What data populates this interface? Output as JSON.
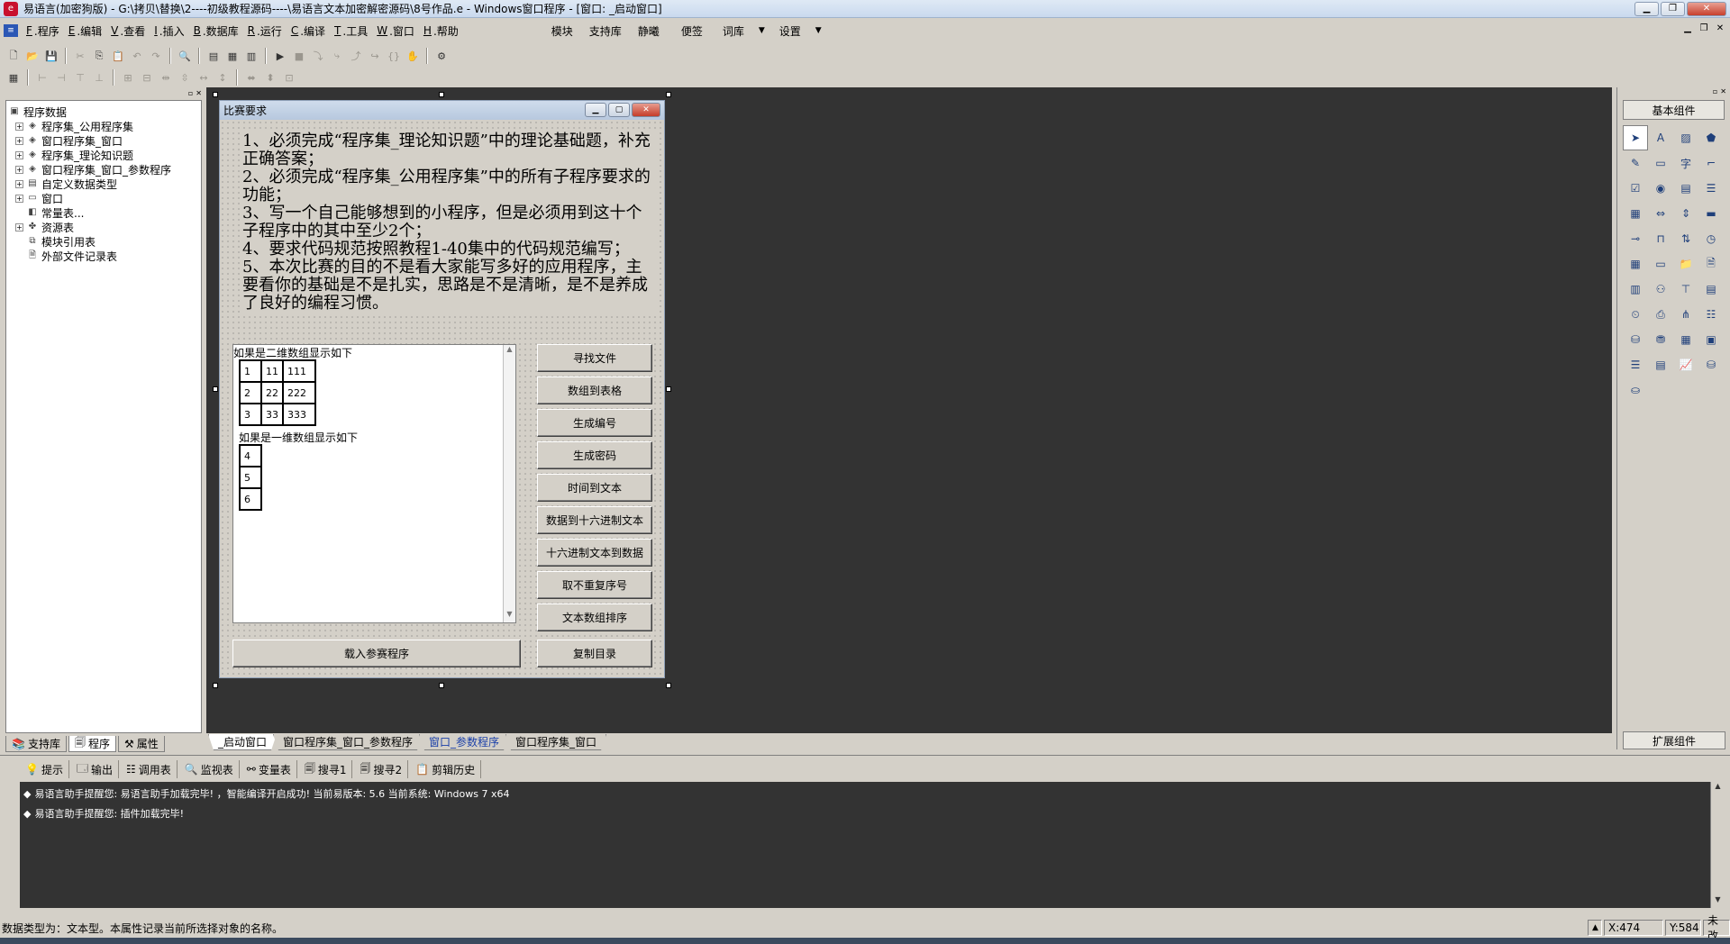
{
  "app": {
    "title": "易语言(加密狗版) - G:\\拷贝\\替换\\2----初级教程源码----\\易语言文本加密解密源码\\8号作品.e - Windows窗口程序 - [窗口: _启动窗口]",
    "icon": "e-lang-app-icon",
    "window_buttons": [
      "minimize-icon",
      "restore-icon",
      "close-icon"
    ]
  },
  "menu": {
    "items": [
      {
        "key": "F",
        "label": ".程序"
      },
      {
        "key": "E",
        "label": ".编辑"
      },
      {
        "key": "V",
        "label": ".查看"
      },
      {
        "key": "I",
        "label": ".插入"
      },
      {
        "key": "B",
        "label": ".数据库"
      },
      {
        "key": "R",
        "label": ".运行"
      },
      {
        "key": "C",
        "label": ".编译"
      },
      {
        "key": "T",
        "label": ".工具"
      },
      {
        "key": "W",
        "label": ".窗口"
      },
      {
        "key": "H",
        "label": ".帮助"
      }
    ],
    "extra": [
      "模块",
      "支持库",
      "静曦",
      "便签",
      "词库",
      "设置"
    ]
  },
  "project_tree": {
    "root": "程序数据",
    "items": [
      {
        "label": "程序集_公用程序集",
        "icon": "module-icon",
        "expandable": true
      },
      {
        "label": "窗口程序集_窗口",
        "icon": "module-icon",
        "expandable": true
      },
      {
        "label": "程序集_理论知识题",
        "icon": "module-icon",
        "expandable": true
      },
      {
        "label": "窗口程序集_窗口_参数程序",
        "icon": "module-icon",
        "expandable": true
      },
      {
        "label": "自定义数据类型",
        "icon": "datatype-icon",
        "expandable": true
      },
      {
        "label": "窗口",
        "icon": "window-icon",
        "expandable": true
      },
      {
        "label": "常量表...",
        "icon": "constant-icon",
        "expandable": false
      },
      {
        "label": "资源表",
        "icon": "resource-icon",
        "expandable": true
      },
      {
        "label": "模块引用表",
        "icon": "module-ref-icon",
        "expandable": false
      },
      {
        "label": "外部文件记录表",
        "icon": "file-record-icon",
        "expandable": false
      }
    ]
  },
  "left_tabs": [
    "支持库",
    "程序",
    "属性"
  ],
  "form": {
    "title": "比赛要求",
    "description": "1、必须完成“程序集_理论知识题”中的理论基础题，补充正确答案；\n2、必须完成“程序集_公用程序集”中的所有子程序要求的功能；\n3、写一个自己能够想到的小程序，但是必须用到这十个子程序中的其中至少2个；\n4、要求代码规范按照教程1-40集中的代码规范编写；\n5、本次比赛的目的不是看大家能写多好的应用程序，主要看你的基础是不是扎实，思路是不是清晰，是不是养成了良好的编程习惯。",
    "grid_caption_2d": "如果是二维数组显示如下",
    "grid_2d": [
      [
        "1",
        "11",
        "111"
      ],
      [
        "2",
        "22",
        "222"
      ],
      [
        "3",
        "33",
        "333"
      ]
    ],
    "grid_caption_1d": "如果是一维数组显示如下",
    "grid_1d": [
      "4",
      "5",
      "6"
    ],
    "buttons": [
      "寻找文件",
      "数组到表格",
      "生成编号",
      "生成密码",
      "时间到文本",
      "数据到十六进制文本",
      "十六进制文本到数据",
      "取不重复序号",
      "文本数组排序"
    ],
    "load_button": "载入参赛程序",
    "copy_button": "复制目录"
  },
  "components": {
    "header": "基本组件",
    "footer": "扩展组件"
  },
  "doc_tabs": [
    {
      "label": "_启动窗口",
      "active": true
    },
    {
      "label": "窗口程序集_窗口_参数程序",
      "active": false
    },
    {
      "label": "窗口_参数程序",
      "active": false
    },
    {
      "label": "窗口程序集_窗口",
      "active": false
    }
  ],
  "output_tabs": [
    "提示",
    "输出",
    "调用表",
    "监视表",
    "变量表",
    "搜寻1",
    "搜寻2",
    "剪辑历史"
  ],
  "output_lines": [
    "易语言助手提醒您: 易语言助手加载完毕! ，智能编译开启成功! 当前易版本: 5.6 当前系统: Windows 7 x64",
    "易语言助手提醒您: 插件加载完毕!"
  ],
  "status": {
    "message": "数据类型为：文本型。本属性记录当前所选择对象的名称。",
    "x": "X:474",
    "y": "Y:584",
    "state": "未改"
  }
}
